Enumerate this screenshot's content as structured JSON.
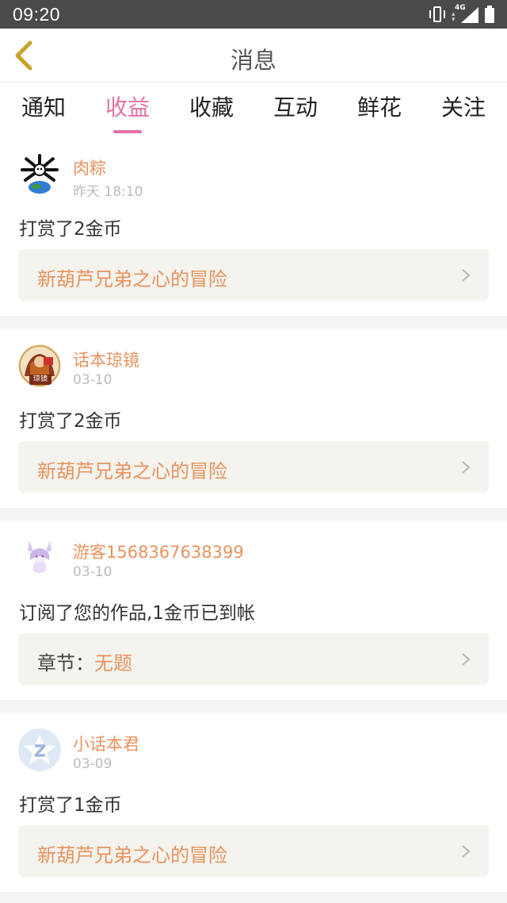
{
  "status_bar": {
    "time": "09:20",
    "network": "4G"
  },
  "header": {
    "title": "消息"
  },
  "tabs": [
    {
      "label": "通知",
      "active": false
    },
    {
      "label": "收益",
      "active": true
    },
    {
      "label": "收藏",
      "active": false
    },
    {
      "label": "互动",
      "active": false
    },
    {
      "label": "鲜花",
      "active": false
    },
    {
      "label": "关注",
      "active": false
    }
  ],
  "messages": [
    {
      "username": "肉粽",
      "time": "昨天 18:10",
      "action": "打赏了2金币",
      "link_prefix": "",
      "link_text": "新葫芦兄弟之心的冒险"
    },
    {
      "username": "话本琼镜",
      "time": "03-10",
      "action": "打赏了2金币",
      "link_prefix": "",
      "link_text": "新葫芦兄弟之心的冒险",
      "avatar_text": "琼镜"
    },
    {
      "username": "游客1568367638399",
      "time": "03-10",
      "action": "订阅了您的作品,1金币已到帐",
      "link_prefix": "章节：",
      "link_text": "无题"
    },
    {
      "username": "小话本君",
      "time": "03-09",
      "action": "打赏了1金币",
      "link_prefix": "",
      "link_text": "新葫芦兄弟之心的冒险"
    }
  ],
  "colors": {
    "accent_pink": "#e472a3",
    "accent_orange": "#e8935e",
    "link_bg": "#f4f3ee",
    "status_bar": "#4a4a4a"
  }
}
